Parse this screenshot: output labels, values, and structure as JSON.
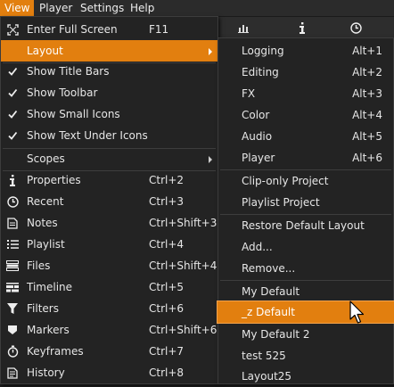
{
  "menubar": {
    "items": [
      {
        "label": "View",
        "active": true
      },
      {
        "label": "Player",
        "active": false
      },
      {
        "label": "Settings",
        "active": false
      },
      {
        "label": "Help",
        "active": false
      }
    ]
  },
  "background_toolbar": {
    "icons": [
      "audio-meter-icon",
      "info-icon",
      "clock-icon"
    ]
  },
  "view_menu": {
    "items": [
      {
        "icon": "fullscreen-icon",
        "label": "Enter Full Screen",
        "shortcut": "F11"
      },
      {
        "icon": "",
        "label": "Layout",
        "shortcut": "",
        "submenu": true,
        "highlighted": true
      },
      {
        "icon": "checkmark-icon",
        "label": "Show Title Bars",
        "shortcut": ""
      },
      {
        "icon": "checkmark-icon",
        "label": "Show Toolbar",
        "shortcut": ""
      },
      {
        "icon": "checkmark-icon",
        "label": "Show Small Icons",
        "shortcut": ""
      },
      {
        "icon": "checkmark-icon",
        "label": "Show Text Under Icons",
        "shortcut": ""
      },
      {
        "icon": "",
        "label": "Scopes",
        "shortcut": "",
        "submenu": true
      },
      {
        "icon": "info-icon",
        "label": "Properties",
        "shortcut": "Ctrl+2"
      },
      {
        "icon": "clock-icon",
        "label": "Recent",
        "shortcut": "Ctrl+3"
      },
      {
        "icon": "notes-icon",
        "label": "Notes",
        "shortcut": "Ctrl+Shift+3"
      },
      {
        "icon": "playlist-icon",
        "label": "Playlist",
        "shortcut": "Ctrl+4"
      },
      {
        "icon": "files-icon",
        "label": "Files",
        "shortcut": "Ctrl+Shift+4"
      },
      {
        "icon": "timeline-icon",
        "label": "Timeline",
        "shortcut": "Ctrl+5"
      },
      {
        "icon": "filter-icon",
        "label": "Filters",
        "shortcut": "Ctrl+6"
      },
      {
        "icon": "marker-icon",
        "label": "Markers",
        "shortcut": "Ctrl+Shift+6"
      },
      {
        "icon": "stopwatch-icon",
        "label": "Keyframes",
        "shortcut": "Ctrl+7"
      },
      {
        "icon": "history-icon",
        "label": "History",
        "shortcut": "Ctrl+8"
      }
    ]
  },
  "layout_menu": {
    "items": [
      {
        "label": "Logging",
        "shortcut": "Alt+1"
      },
      {
        "label": "Editing",
        "shortcut": "Alt+2"
      },
      {
        "label": "FX",
        "shortcut": "Alt+3"
      },
      {
        "label": "Color",
        "shortcut": "Alt+4"
      },
      {
        "label": "Audio",
        "shortcut": "Alt+5"
      },
      {
        "label": "Player",
        "shortcut": "Alt+6"
      },
      {
        "label": "Clip-only Project",
        "shortcut": ""
      },
      {
        "label": "Playlist Project",
        "shortcut": ""
      },
      {
        "label": "Restore Default Layout",
        "shortcut": ""
      },
      {
        "label": "Add...",
        "shortcut": ""
      },
      {
        "label": "Remove...",
        "shortcut": ""
      },
      {
        "label": "My Default",
        "shortcut": ""
      },
      {
        "label": "_z Default",
        "shortcut": "",
        "highlighted": true
      },
      {
        "label": "My Default 2",
        "shortcut": ""
      },
      {
        "label": "test 525",
        "shortcut": ""
      },
      {
        "label": "Layout25",
        "shortcut": ""
      }
    ]
  },
  "colors": {
    "accent": "#e27f0f",
    "menu_bg": "#232323",
    "text": "#e6e6e6"
  }
}
